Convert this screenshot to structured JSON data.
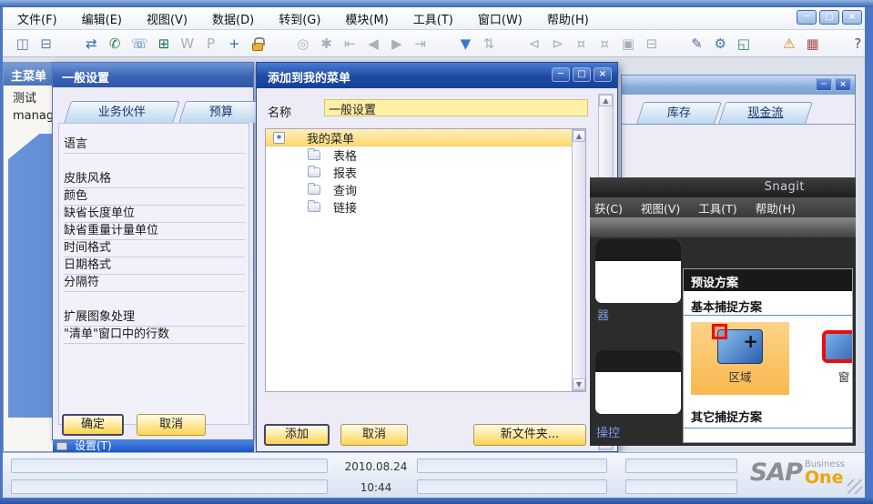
{
  "chrome": {
    "menu_items": [
      "文件(F)",
      "编辑(E)",
      "视图(V)",
      "数据(D)",
      "转到(G)",
      "模块(M)",
      "工具(T)",
      "窗口(W)",
      "帮助(H)"
    ],
    "glyphs": {
      "minimize": "─",
      "maximize": "□",
      "close": "×",
      "up": "▲",
      "down": "▼"
    }
  },
  "toolbar": {
    "icons": [
      {
        "name": "print-preview-icon",
        "glyph": "◫",
        "color": "#5f7da6"
      },
      {
        "name": "print-icon",
        "glyph": "⊟",
        "color": "#5f7da6"
      },
      {
        "name": "send-message-icon",
        "glyph": "⇄",
        "color": "#2f6cb0",
        "gap": true
      },
      {
        "name": "mobile-phone-icon",
        "glyph": "✆",
        "color": "#2e7d4f"
      },
      {
        "name": "fax-icon",
        "glyph": "☏",
        "color": "#2f6cb0"
      },
      {
        "name": "excel-export-icon",
        "glyph": "⊞",
        "color": "#1e7145"
      },
      {
        "name": "word-export-icon",
        "glyph": "W",
        "color": "#a8b0bc"
      },
      {
        "name": "pdf-export-icon",
        "glyph": "P",
        "color": "#a8b0bc"
      },
      {
        "name": "navigate-icon",
        "glyph": "+",
        "color": "#2f6cb0"
      },
      {
        "name": "lock-icon",
        "shape": "lock",
        "color": "#e0a020"
      },
      {
        "name": "find-icon",
        "glyph": "◎",
        "color": "#a8b0bc",
        "gap": true
      },
      {
        "name": "add-record-icon",
        "glyph": "✱",
        "color": "#a8b0bc"
      },
      {
        "name": "first-record-icon",
        "glyph": "⇤",
        "color": "#a8b0bc"
      },
      {
        "name": "previous-record-icon",
        "glyph": "◀",
        "color": "#a8b0bc"
      },
      {
        "name": "next-record-icon",
        "glyph": "▶",
        "color": "#a8b0bc"
      },
      {
        "name": "last-record-icon",
        "glyph": "⇥",
        "color": "#a8b0bc"
      },
      {
        "name": "filter-icon",
        "glyph": "▼",
        "color": "#2f7cd0",
        "gap": true
      },
      {
        "name": "sort-icon",
        "glyph": "⇅",
        "color": "#a8b0bc"
      },
      {
        "name": "previous-document-icon",
        "glyph": "⊲",
        "color": "#a8b0bc",
        "gap": true
      },
      {
        "name": "next-document-icon",
        "glyph": "⊳",
        "color": "#a8b0bc"
      },
      {
        "name": "payment-means-icon",
        "glyph": "¤",
        "color": "#a8b0bc"
      },
      {
        "name": "gross-profit-icon",
        "glyph": "¤",
        "color": "#a8b0bc"
      },
      {
        "name": "copy-table-icon",
        "glyph": "▣",
        "color": "#a8b0bc"
      },
      {
        "name": "journal-icon",
        "glyph": "⊟",
        "color": "#a8b0bc"
      },
      {
        "name": "edit-pencil-icon",
        "glyph": "✎",
        "color": "#51669a",
        "gap": true
      },
      {
        "name": "form-settings-gear-icon",
        "glyph": "⚙",
        "color": "#3f74ae"
      },
      {
        "name": "query-form-icon",
        "glyph": "◱",
        "color": "#2f8a56"
      },
      {
        "name": "alert-warning-icon",
        "glyph": "⚠",
        "color": "#e07818",
        "gap": true
      },
      {
        "name": "calendar-icon",
        "glyph": "▦",
        "color": "#b05050"
      },
      {
        "name": "help-icon",
        "glyph": "?",
        "color": "#555555",
        "gap": true
      }
    ]
  },
  "main_menu_window": {
    "title": "主菜单",
    "items": [
      "测试",
      "manag"
    ]
  },
  "general_settings_window": {
    "title": "一般设置",
    "tabs": [
      "业务伙伴",
      "预算"
    ],
    "rows": [
      "语言",
      null,
      "皮肤风格",
      "颜色",
      "缺省长度单位",
      "缺省重量计量单位",
      "时间格式",
      "日期格式",
      "分隔符",
      null,
      "扩展图象处理",
      "\"清单\"窗口中的行数"
    ],
    "ok_label": "确定",
    "cancel_label": "取消"
  },
  "highlighted_menu_row": {
    "label": "设置(T)"
  },
  "add_to_my_menu_dialog": {
    "title": "添加到我的菜单",
    "name_label": "名称",
    "name_value": "一般设置",
    "tree_root": "我的菜单",
    "tree_children": [
      "表格",
      "报表",
      "查询",
      "链接"
    ],
    "add_label": "添加",
    "cancel_label": "取消",
    "new_folder_label": "新文件夹..."
  },
  "inventory_window": {
    "tabs": [
      {
        "label": "库存",
        "underline": false
      },
      {
        "label": "现金流",
        "underline": true
      }
    ]
  },
  "snagit_window": {
    "title": "Snagit",
    "menu_items": [
      "获(C)",
      "视图(V)",
      "工具(T)",
      "帮助(H)"
    ],
    "thumb_labels": [
      "器",
      "操控"
    ],
    "presets_panel": {
      "header": "预设方案",
      "section_basic": "基本捕捉方案",
      "tile_region_label": "区域",
      "tile_window_label": "窗",
      "section_other": "其它捕捉方案"
    }
  },
  "status_bar": {
    "date": "2010.08.24",
    "time": "10:44"
  },
  "logo": {
    "sap": "SAP",
    "business": "Business",
    "one": "One"
  }
}
